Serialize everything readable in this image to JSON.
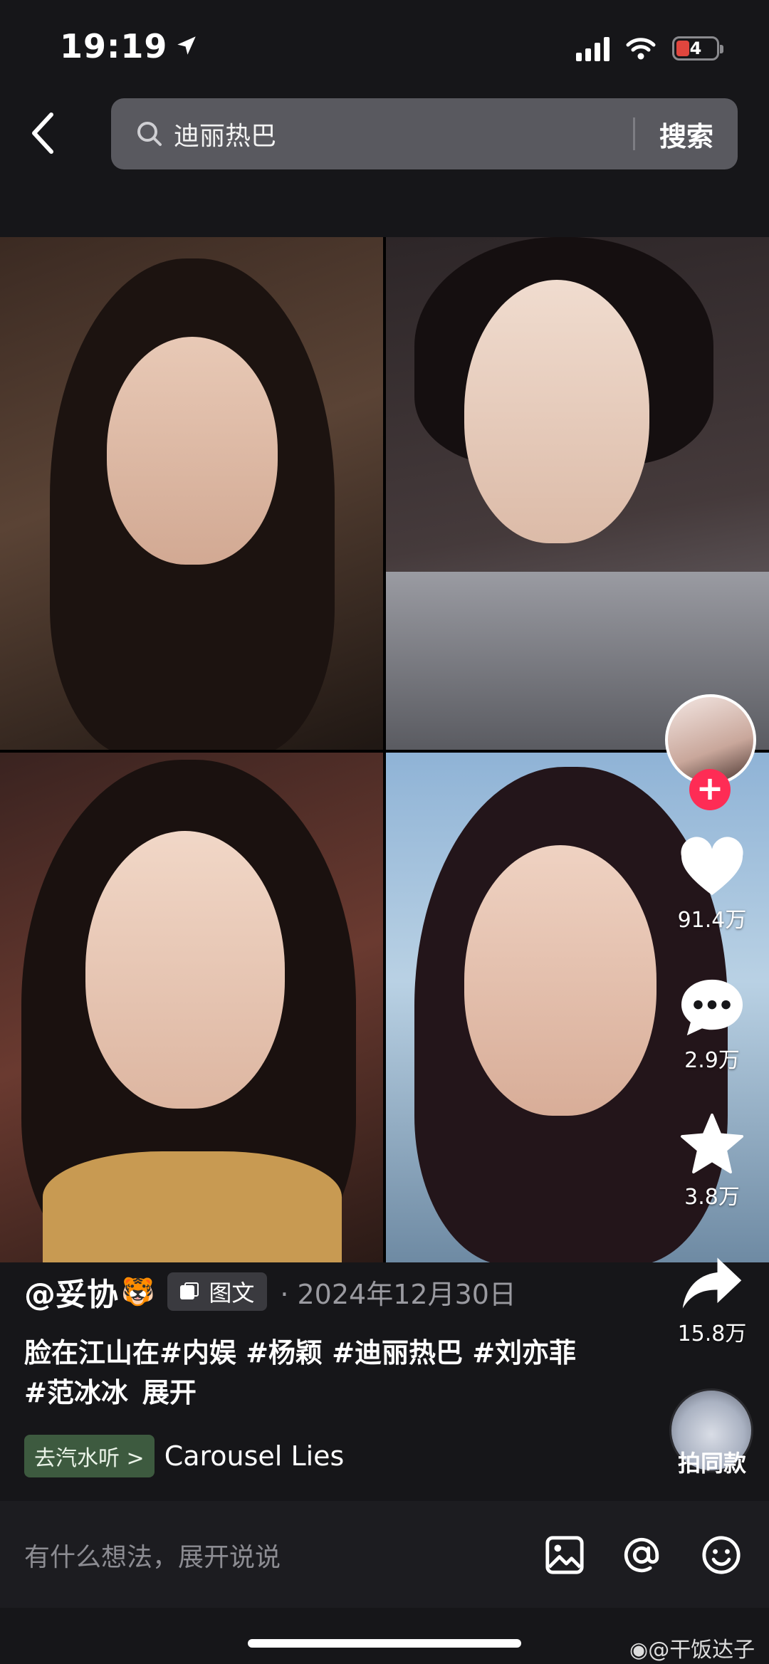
{
  "status": {
    "time": "19:19",
    "battery": "4"
  },
  "search": {
    "query": "迪丽热巴",
    "button": "搜索"
  },
  "actions": {
    "likes": "91.4万",
    "comments": "2.9万",
    "favorites": "3.8万",
    "shares": "15.8万",
    "same_style": "拍同款"
  },
  "post": {
    "author": "@妥协",
    "author_emoji": "🐯",
    "type_tag": "图文",
    "date": "· 2024年12月30日",
    "caption": "脸在江山在#内娱 #杨颖 #迪丽热巴 #刘亦菲 #范冰冰",
    "expand": "展开",
    "music_chip": "去汽水听 >",
    "music_name": "Carousel Lies"
  },
  "comment": {
    "placeholder": "有什么想法，展开说说"
  },
  "watermark": "@干饭达子",
  "colors": {
    "background": "#161619",
    "follow": "#fe2c55",
    "search_bg": "#59595f"
  }
}
